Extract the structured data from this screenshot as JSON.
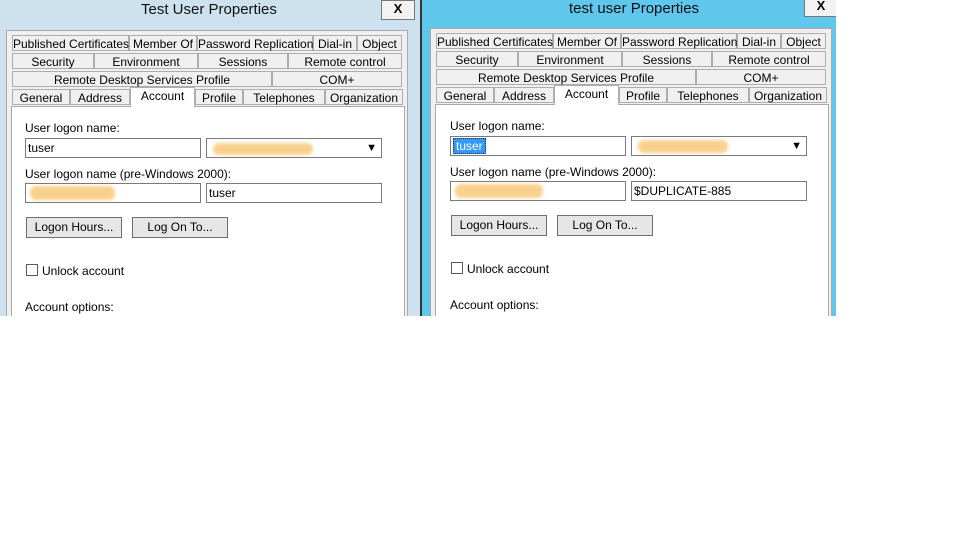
{
  "left": {
    "title": "Test User Properties",
    "close": "X",
    "tabs_row1": [
      "Published Certificates",
      "Member Of",
      "Password Replication",
      "Dial-in",
      "Object"
    ],
    "tabs_row2": [
      "Security",
      "Environment",
      "Sessions",
      "Remote control"
    ],
    "tabs_row3": [
      "Remote Desktop Services Profile",
      "COM+"
    ],
    "tabs_row4": [
      "General",
      "Address",
      "Account",
      "Profile",
      "Telephones",
      "Organization"
    ],
    "logon_label": "User logon name:",
    "logon_value": "tuser",
    "pre2000_label": "User logon name (pre-Windows 2000):",
    "pre2000_value": "tuser",
    "logon_hours": "Logon Hours...",
    "log_on_to": "Log On To...",
    "unlock": "Unlock account",
    "account_options": "Account options:"
  },
  "right": {
    "title": "test user Properties",
    "close": "X",
    "tabs_row1": [
      "Published Certificates",
      "Member Of",
      "Password Replication",
      "Dial-in",
      "Object"
    ],
    "tabs_row2": [
      "Security",
      "Environment",
      "Sessions",
      "Remote control"
    ],
    "tabs_row3": [
      "Remote Desktop Services Profile",
      "COM+"
    ],
    "tabs_row4": [
      "General",
      "Address",
      "Account",
      "Profile",
      "Telephones",
      "Organization"
    ],
    "logon_label": "User logon name:",
    "logon_value": "tuser",
    "pre2000_label": "User logon name (pre-Windows 2000):",
    "pre2000_value": "$DUPLICATE-885",
    "logon_hours": "Logon Hours...",
    "log_on_to": "Log On To...",
    "unlock": "Unlock account",
    "account_options": "Account options:"
  },
  "colors": {
    "left_frame": "#cde1ef",
    "right_frame": "#5fc6ec",
    "selection": "#3399ff",
    "redaction": "#f8c97a"
  },
  "icons": {
    "close": "close-icon",
    "dropdown": "chevron-down-icon",
    "checkbox": "checkbox-icon"
  }
}
